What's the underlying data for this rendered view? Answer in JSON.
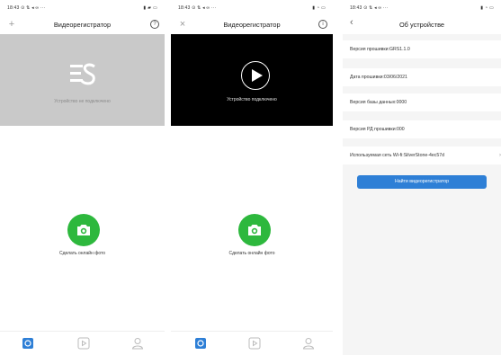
{
  "colors": {
    "accent_green": "#2db83d",
    "accent_blue": "#2e7fd6",
    "active_tab": "#2e7fd6",
    "inactive_tab": "#bbbbbb"
  },
  "screen1": {
    "status_time": "18:43",
    "status_icons": "⊙ ⇅ ◂ ∞ ···",
    "status_right": "▮ ▰ ▭",
    "title": "Видеорегистратор",
    "left_icon": "plus-icon",
    "right_icon": "help-icon",
    "video_message": "Устройство не подключено",
    "shoot_label": "Сделать онлайн фото"
  },
  "screen2": {
    "status_time": "18:43",
    "status_icons": "⊙ ⇅ ◂ ∞ ···",
    "status_right": "▮ ◔ ▭",
    "title": "Видеорегистратор",
    "left_icon": "close-icon",
    "right_icon": "info-icon",
    "video_message": "Устройство подключено",
    "shoot_label": "Сделать онлайн фото"
  },
  "screen3": {
    "status_time": "18:43",
    "status_icons": "⊙ ⇅ ◂ ∞ ···",
    "status_right": "▮ ◔ ▭",
    "title": "Об устройстве",
    "rows": [
      {
        "label": "Версия прошивки:GRS1.1.0"
      },
      {
        "label": "Дата прошивки:03/06/2021"
      },
      {
        "label": "Версия базы данных:0000"
      },
      {
        "label": "Версия РД прошивки:000"
      },
      {
        "label": "Используемая сеть Wi-fi:SilverStone-4ec57d"
      }
    ],
    "find_button": "Найти видеорегистратор"
  },
  "bottom_tabs": [
    "home-tab",
    "playback-tab",
    "profile-tab"
  ]
}
